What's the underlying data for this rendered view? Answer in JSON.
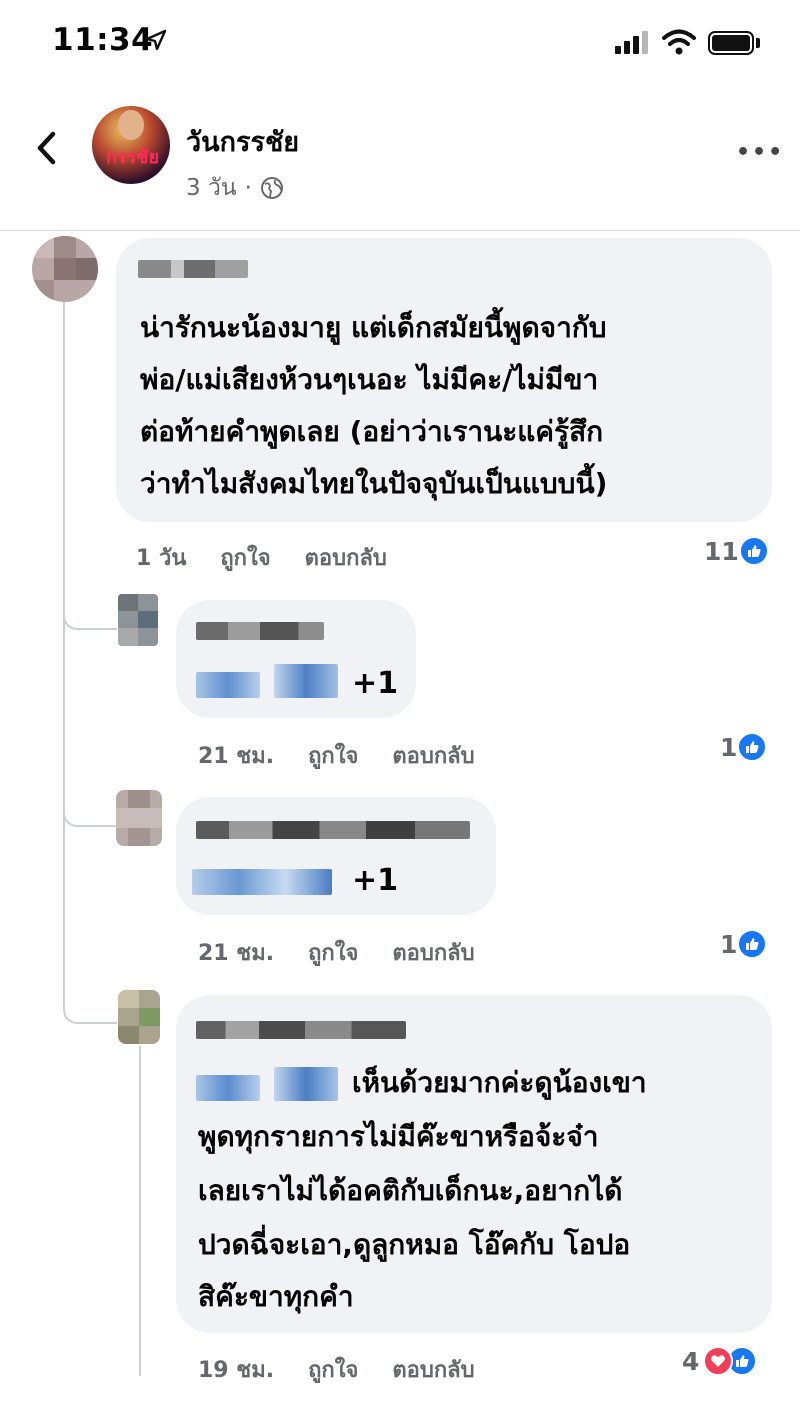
{
  "status_bar": {
    "time": "11:34"
  },
  "header": {
    "page_name": "วันกรรชัย",
    "post_age": "3 วัน",
    "meta_separator": "·",
    "more_label": "•••",
    "avatar_logo": "กรรชัย"
  },
  "comments": [
    {
      "text_lines": [
        "น่ารักนะน้องมายู แต่เด็กสมัยนี้พูดจากับ",
        "พ่อ/แม่เสียงห้วนๆเนอะ ไม่มีคะ/ไม่มีขา",
        "ต่อท้ายคำพูดเลย (อย่าว่าเรานะแค่รู้สึก",
        "ว่าทำไมสังคมไทยในปัจจุบันเป็นแบบนี้)"
      ],
      "time": "1 วัน",
      "like_label": "ถูกใจ",
      "reply_label": "ตอบกลับ",
      "reactions": "11"
    },
    {
      "text": "+1",
      "time": "21 ชม.",
      "like_label": "ถูกใจ",
      "reply_label": "ตอบกลับ",
      "reactions": "1"
    },
    {
      "text": "+1",
      "time": "21 ชม.",
      "like_label": "ถูกใจ",
      "reply_label": "ตอบกลับ",
      "reactions": "1"
    },
    {
      "text_lines": [
        "เห็นด้วยมากค่ะดูน้องเขา",
        "พูดทุกรายการไม่มีค๊ะขาหรือจ้ะจ๋า",
        "เลยเราไม่ได้อคติกับเด็กนะ,อยากได้",
        "ปวดฉี่จะเอา,ดูลูกหมอ โอ๊คกับ โอปอ",
        "สิค๊ะขาทุกคำ"
      ],
      "time": "19 ชม.",
      "like_label": "ถูกใจ",
      "reply_label": "ตอบกลับ",
      "reactions": "4"
    }
  ],
  "colors": {
    "like_blue": "#1877f2",
    "love_red": "#f33e58",
    "bubble_bg": "#f0f2f5",
    "meta_gray": "#65676b"
  },
  "icons": [
    "location-arrow-icon",
    "signal-icon",
    "wifi-icon",
    "battery-icon",
    "back-chevron-icon",
    "globe-icon",
    "more-icon",
    "like-icon",
    "love-icon"
  ]
}
